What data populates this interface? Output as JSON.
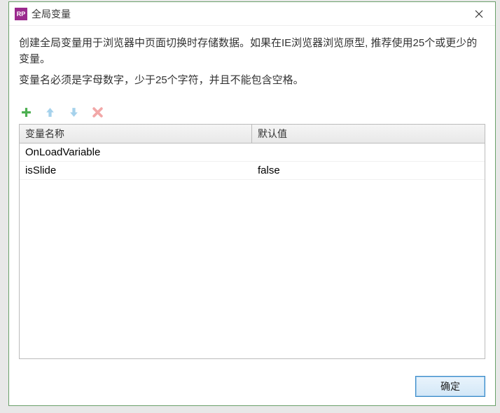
{
  "titlebar": {
    "title": "全局变量"
  },
  "description": {
    "line1": "创建全局变量用于浏览器中页面切换时存储数据。如果在IE浏览器浏览原型, 推荐使用25个或更少的变量。",
    "line2": "变量名必须是字母数字，少于25个字符，并且不能包含空格。"
  },
  "toolbar": {
    "add_icon": "plus-icon",
    "up_icon": "arrow-up-icon",
    "down_icon": "arrow-down-icon",
    "delete_icon": "x-icon"
  },
  "table": {
    "headers": {
      "name": "变量名称",
      "default": "默认值"
    },
    "rows": [
      {
        "name": "OnLoadVariable",
        "default": ""
      },
      {
        "name": "isSlide",
        "default": "false"
      }
    ]
  },
  "buttons": {
    "ok": "确定"
  },
  "colors": {
    "accent_green": "#4caf50",
    "arrow_blue": "#a6d2ec",
    "delete_pink": "#f2a8a8",
    "border_green": "#6aa06a",
    "app_purple": "#9b2a8e"
  }
}
